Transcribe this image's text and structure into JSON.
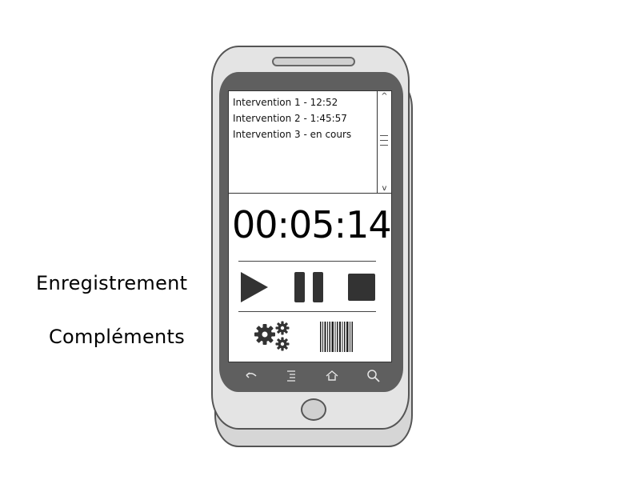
{
  "side_labels": {
    "recording": "Enregistrement",
    "complements": "Compléments"
  },
  "interventions": {
    "items": [
      "Intervention 1 - 12:52",
      "Intervention 2 - 1:45:57",
      "Intervention 3 - en cours"
    ]
  },
  "scrollbar": {
    "up_icon": "chevron-up-icon",
    "down_icon": "chevron-down-icon",
    "up_glyph": "^",
    "down_glyph": "v"
  },
  "timer": {
    "value": "00:05:14"
  },
  "controls": {
    "play_icon": "play-icon",
    "pause_icon": "pause-icon",
    "stop_icon": "stop-icon"
  },
  "complements": {
    "settings_icon": "gears-icon",
    "barcode_icon": "barcode-icon"
  },
  "nav_keys": {
    "back_icon": "back-icon",
    "menu_icon": "menu-icon",
    "home_icon": "home-icon",
    "search_icon": "search-icon"
  },
  "colors": {
    "bezel": "#5f5f5f",
    "phone_body": "#e4e4e4",
    "controls": "#333333"
  }
}
